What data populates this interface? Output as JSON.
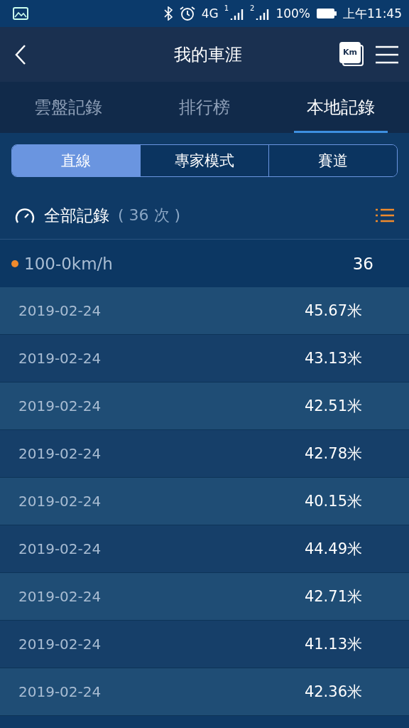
{
  "status_bar": {
    "network": "4G",
    "sim_1": "1",
    "sim_2": "2",
    "battery": "100%",
    "time": "上午11:45"
  },
  "header": {
    "title": "我的車涯",
    "unit_badge": "Km"
  },
  "tabs": [
    {
      "label": "雲盤記錄",
      "selected": false
    },
    {
      "label": "排行榜",
      "selected": false
    },
    {
      "label": "本地記錄",
      "selected": true
    }
  ],
  "segments": [
    {
      "label": "直線",
      "selected": true
    },
    {
      "label": "專家模式",
      "selected": false
    },
    {
      "label": "賽道",
      "selected": false
    }
  ],
  "summary": {
    "title": "全部記錄",
    "count": "( 36 次 )"
  },
  "category": {
    "label": "100-0km/h",
    "count": "36",
    "color": "#f08a2c"
  },
  "records": [
    {
      "date": "2019-02-24",
      "distance": "45.67米"
    },
    {
      "date": "2019-02-24",
      "distance": "43.13米"
    },
    {
      "date": "2019-02-24",
      "distance": "42.51米"
    },
    {
      "date": "2019-02-24",
      "distance": "42.78米"
    },
    {
      "date": "2019-02-24",
      "distance": "40.15米"
    },
    {
      "date": "2019-02-24",
      "distance": "44.49米"
    },
    {
      "date": "2019-02-24",
      "distance": "42.71米"
    },
    {
      "date": "2019-02-24",
      "distance": "41.13米"
    },
    {
      "date": "2019-02-24",
      "distance": "42.36米"
    }
  ]
}
